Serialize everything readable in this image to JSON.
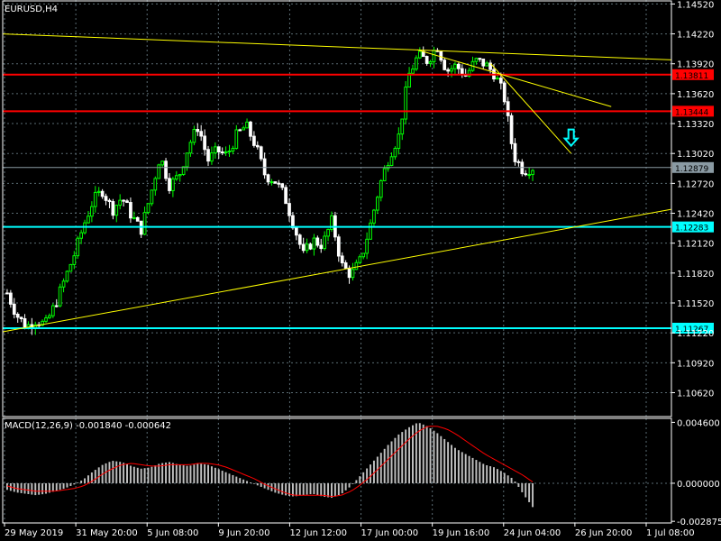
{
  "symbol_label": "EURUSD,H4",
  "macd_label": "MACD(12,26,9) -0.001840 -0.000642",
  "colors": {
    "background": "#000000",
    "grid": "#5a6b73",
    "candle_up": "#00ff00",
    "candle_down": "#ffffff",
    "resistance": "#ff0000",
    "support": "#00ffff",
    "trendline": "#ffff00",
    "macd_hist": "#c0c0c0",
    "macd_signal": "#ff0000",
    "arrow": "#00ffff"
  },
  "chart_data": [
    {
      "type": "candlestick",
      "title": "EURUSD,H4",
      "ylim": [
        1.1038,
        1.1456
      ],
      "y_ticks": [
        "1.14520",
        "1.14220",
        "1.13920",
        "1.13620",
        "1.13320",
        "1.13020",
        "1.12720",
        "1.12420",
        "1.12120",
        "1.11820",
        "1.11520",
        "1.11220",
        "1.10920",
        "1.10620"
      ],
      "y_tick_values": [
        1.1452,
        1.1422,
        1.1392,
        1.1362,
        1.1332,
        1.1302,
        1.1272,
        1.1242,
        1.1212,
        1.1182,
        1.1152,
        1.1122,
        1.1092,
        1.1062
      ],
      "x_labels": [
        "29 May 2019",
        "31 May 20:00",
        "5 Jun 08:00",
        "9 Jun 20:00",
        "12 Jun 12:00",
        "17 Jun 00:00",
        "19 Jun 16:00",
        "24 Jun 04:00",
        "26 Jun 20:00",
        "1 Jul 08:00"
      ],
      "close_path": [
        1.1162,
        1.114,
        1.1128,
        1.1135,
        1.113,
        1.115,
        1.1175,
        1.12,
        1.123,
        1.1255,
        1.1265,
        1.1245,
        1.1258,
        1.124,
        1.1225,
        1.126,
        1.13,
        1.127,
        1.128,
        1.131,
        1.133,
        1.1295,
        1.1305,
        1.13,
        1.132,
        1.133,
        1.131,
        1.128,
        1.1275,
        1.126,
        1.123,
        1.12,
        1.1215,
        1.121,
        1.1235,
        1.119,
        1.118,
        1.1195,
        1.123,
        1.127,
        1.13,
        1.132,
        1.138,
        1.14,
        1.1395,
        1.141,
        1.1385,
        1.139,
        1.138,
        1.1395,
        1.1392,
        1.1382,
        1.136,
        1.13,
        1.1285,
        1.12879
      ],
      "horizontal_lines": [
        {
          "label": "1.13811",
          "value": 1.13811,
          "color": "#ff0000"
        },
        {
          "label": "1.13444",
          "value": 1.13444,
          "color": "#ff0000"
        },
        {
          "label": "1.12283",
          "value": 1.12283,
          "color": "#00ffff"
        },
        {
          "label": "1.11267",
          "value": 1.11267,
          "color": "#00ffff"
        }
      ],
      "current_price": "1.12879",
      "current_price_value": 1.12879,
      "trendlines": [
        {
          "from": [
            0,
            1.1422
          ],
          "to": [
            1,
            1.1396
          ]
        },
        {
          "from": [
            0.62,
            1.1406
          ],
          "to": [
            0.91,
            1.1349
          ]
        },
        {
          "from": [
            0.73,
            1.1392
          ],
          "to": [
            0.85,
            1.1302
          ]
        },
        {
          "from": [
            0.0,
            1.1123
          ],
          "to": [
            1.0,
            1.1246
          ]
        }
      ],
      "annotations": [
        {
          "type": "down-arrow",
          "at": [
            0.85,
            1.1317
          ]
        }
      ]
    },
    {
      "type": "bar+line",
      "title": "MACD(12,26,9) -0.001840 -0.000642",
      "ylim": [
        -0.003,
        0.0049
      ],
      "y_ticks": [
        "0.004600",
        "0.000000",
        "-0.002875"
      ],
      "y_tick_values": [
        0.0046,
        0.0,
        -0.002875
      ],
      "histogram": [
        -0.0005,
        -0.0007,
        -0.0008,
        -0.0009,
        -0.0008,
        -0.0006,
        -0.0004,
        -0.0001,
        0.0003,
        0.0009,
        0.0014,
        0.0017,
        0.0016,
        0.0013,
        0.0011,
        0.0012,
        0.0015,
        0.0016,
        0.0014,
        0.0013,
        0.0015,
        0.0014,
        0.0011,
        0.0008,
        0.0005,
        0.0002,
        -0.0001,
        -0.0004,
        -0.0007,
        -0.0009,
        -0.001,
        -0.0009,
        -0.0008,
        -0.001,
        -0.0011,
        -0.0008,
        -0.0002,
        0.0006,
        0.0014,
        0.0022,
        0.003,
        0.0037,
        0.0042,
        0.0046,
        0.0043,
        0.0038,
        0.0032,
        0.0026,
        0.0022,
        0.0018,
        0.0014,
        0.0012,
        0.0008,
        0.0003,
        -0.0008,
        -0.0018
      ],
      "signal": [
        -0.0002,
        -0.0004,
        -0.0005,
        -0.0006,
        -0.0006,
        -0.0006,
        -0.0005,
        -0.0004,
        -0.0002,
        0.0002,
        0.0007,
        0.0011,
        0.0014,
        0.0015,
        0.0014,
        0.0013,
        0.0013,
        0.0014,
        0.0014,
        0.0014,
        0.0015,
        0.0015,
        0.0014,
        0.0012,
        0.0009,
        0.0006,
        0.0003,
        -0.0001,
        -0.0004,
        -0.0007,
        -0.0009,
        -0.0009,
        -0.0009,
        -0.0009,
        -0.001,
        -0.0009,
        -0.0006,
        -0.0001,
        0.0005,
        0.0012,
        0.0019,
        0.0026,
        0.0033,
        0.0039,
        0.0043,
        0.0043,
        0.0041,
        0.0037,
        0.0032,
        0.0027,
        0.0022,
        0.0018,
        0.0014,
        0.001,
        0.0006,
        0.0001
      ]
    }
  ]
}
